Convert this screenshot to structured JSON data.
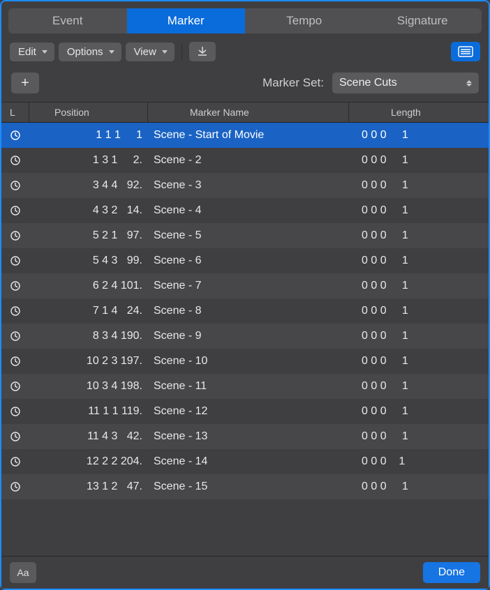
{
  "tabs": {
    "items": [
      {
        "label": "Event",
        "active": false
      },
      {
        "label": "Marker",
        "active": true
      },
      {
        "label": "Tempo",
        "active": false
      },
      {
        "label": "Signature",
        "active": false
      }
    ]
  },
  "toolbar": {
    "edit_label": "Edit",
    "options_label": "Options",
    "view_label": "View"
  },
  "marker_set": {
    "add_glyph": "+",
    "label": "Marker Set:",
    "selected": "Scene Cuts"
  },
  "columns": {
    "l": "L",
    "position": "Position",
    "name": "Marker Name",
    "length": "Length"
  },
  "rows": [
    {
      "pos": "  1 1 1     1",
      "name": "Scene - Start of Movie",
      "len": "0 0 0     1",
      "selected": true
    },
    {
      "pos": "  1 3 1     2.",
      "name": "Scene - 2",
      "len": "0 0 0     1",
      "selected": false
    },
    {
      "pos": "  3 4 4   92.",
      "name": "Scene - 3",
      "len": "0 0 0     1",
      "selected": false
    },
    {
      "pos": "  4 3 2   14.",
      "name": "Scene - 4",
      "len": "0 0 0     1",
      "selected": false
    },
    {
      "pos": "  5 2 1   97.",
      "name": "Scene - 5",
      "len": "0 0 0     1",
      "selected": false
    },
    {
      "pos": "  5 4 3   99.",
      "name": "Scene - 6",
      "len": "0 0 0     1",
      "selected": false
    },
    {
      "pos": "  6 2 4 101.",
      "name": "Scene - 7",
      "len": "0 0 0     1",
      "selected": false
    },
    {
      "pos": "  7 1 4   24.",
      "name": "Scene - 8",
      "len": "0 0 0     1",
      "selected": false
    },
    {
      "pos": "  8 3 4 190.",
      "name": "Scene - 9",
      "len": "0 0 0     1",
      "selected": false
    },
    {
      "pos": "10 2 3 197.",
      "name": "Scene - 10",
      "len": "0 0 0     1",
      "selected": false
    },
    {
      "pos": "10 3 4 198.",
      "name": "Scene - 11",
      "len": "0 0 0     1",
      "selected": false
    },
    {
      "pos": "11 1 1 119.",
      "name": "Scene - 12",
      "len": "0 0 0     1",
      "selected": false
    },
    {
      "pos": "11 4 3   42.",
      "name": "Scene - 13",
      "len": "0 0 0     1",
      "selected": false
    },
    {
      "pos": "12 2 2 204.",
      "name": "Scene - 14",
      "len": "0 0 0    1",
      "selected": false
    },
    {
      "pos": "13 1 2   47.",
      "name": "Scene - 15",
      "len": "0 0 0     1",
      "selected": false
    }
  ],
  "footer": {
    "font_label": "Aa",
    "done_label": "Done"
  }
}
